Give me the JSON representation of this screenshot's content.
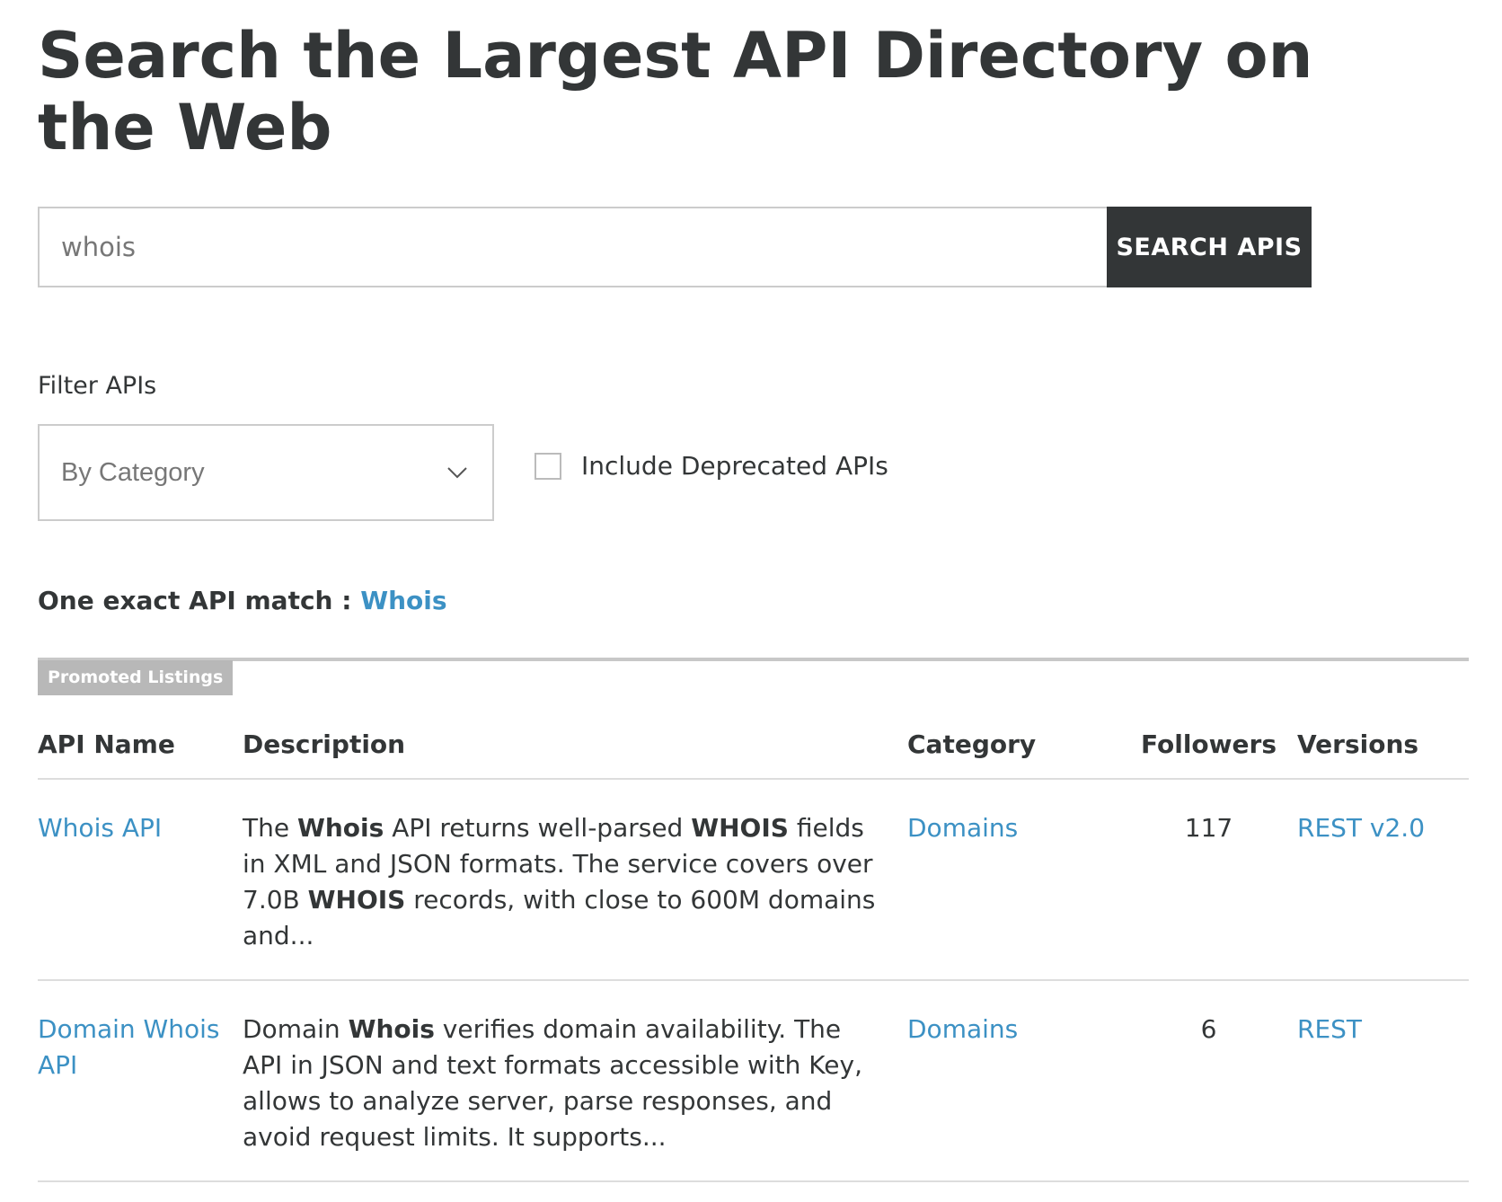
{
  "header": {
    "title": "Search the Largest API Directory on the Web"
  },
  "search": {
    "value": "whois",
    "button_label": "SEARCH APIS"
  },
  "filter": {
    "label": "Filter APIs",
    "category_select": "By Category",
    "deprecated_label": "Include Deprecated APIs",
    "deprecated_checked": false
  },
  "exact_match": {
    "label": "One exact API match :",
    "link": "Whois"
  },
  "promoted": {
    "badge": "Promoted Listings"
  },
  "table": {
    "headers": {
      "name": "API Name",
      "description": "Description",
      "category": "Category",
      "followers": "Followers",
      "versions": "Versions"
    },
    "rows": [
      {
        "name": "Whois API",
        "description_parts": [
          {
            "text": "The ",
            "bold": false
          },
          {
            "text": "Whois",
            "bold": true
          },
          {
            "text": " API returns well-parsed ",
            "bold": false
          },
          {
            "text": "WHOIS",
            "bold": true
          },
          {
            "text": " fields in XML and JSON formats. The service covers over 7.0B ",
            "bold": false
          },
          {
            "text": "WHOIS",
            "bold": true
          },
          {
            "text": " records, with close to 600M domains and...",
            "bold": false
          }
        ],
        "category": "Domains",
        "followers": "117",
        "versions": "REST v2.0"
      },
      {
        "name": "Domain Whois API",
        "description_parts": [
          {
            "text": "Domain ",
            "bold": false
          },
          {
            "text": "Whois",
            "bold": true
          },
          {
            "text": " verifies domain availability. The API in JSON and text formats accessible with Key, allows to analyze server, parse responses, and avoid request limits. It supports...",
            "bold": false
          }
        ],
        "category": "Domains",
        "followers": "6",
        "versions": "REST"
      }
    ]
  },
  "icons": {
    "select_chevron": "chevron-down-icon"
  },
  "colors": {
    "text": "#333637",
    "link": "#3c91c4",
    "button_bg": "#333637",
    "badge_bg": "#b8b8b8"
  }
}
